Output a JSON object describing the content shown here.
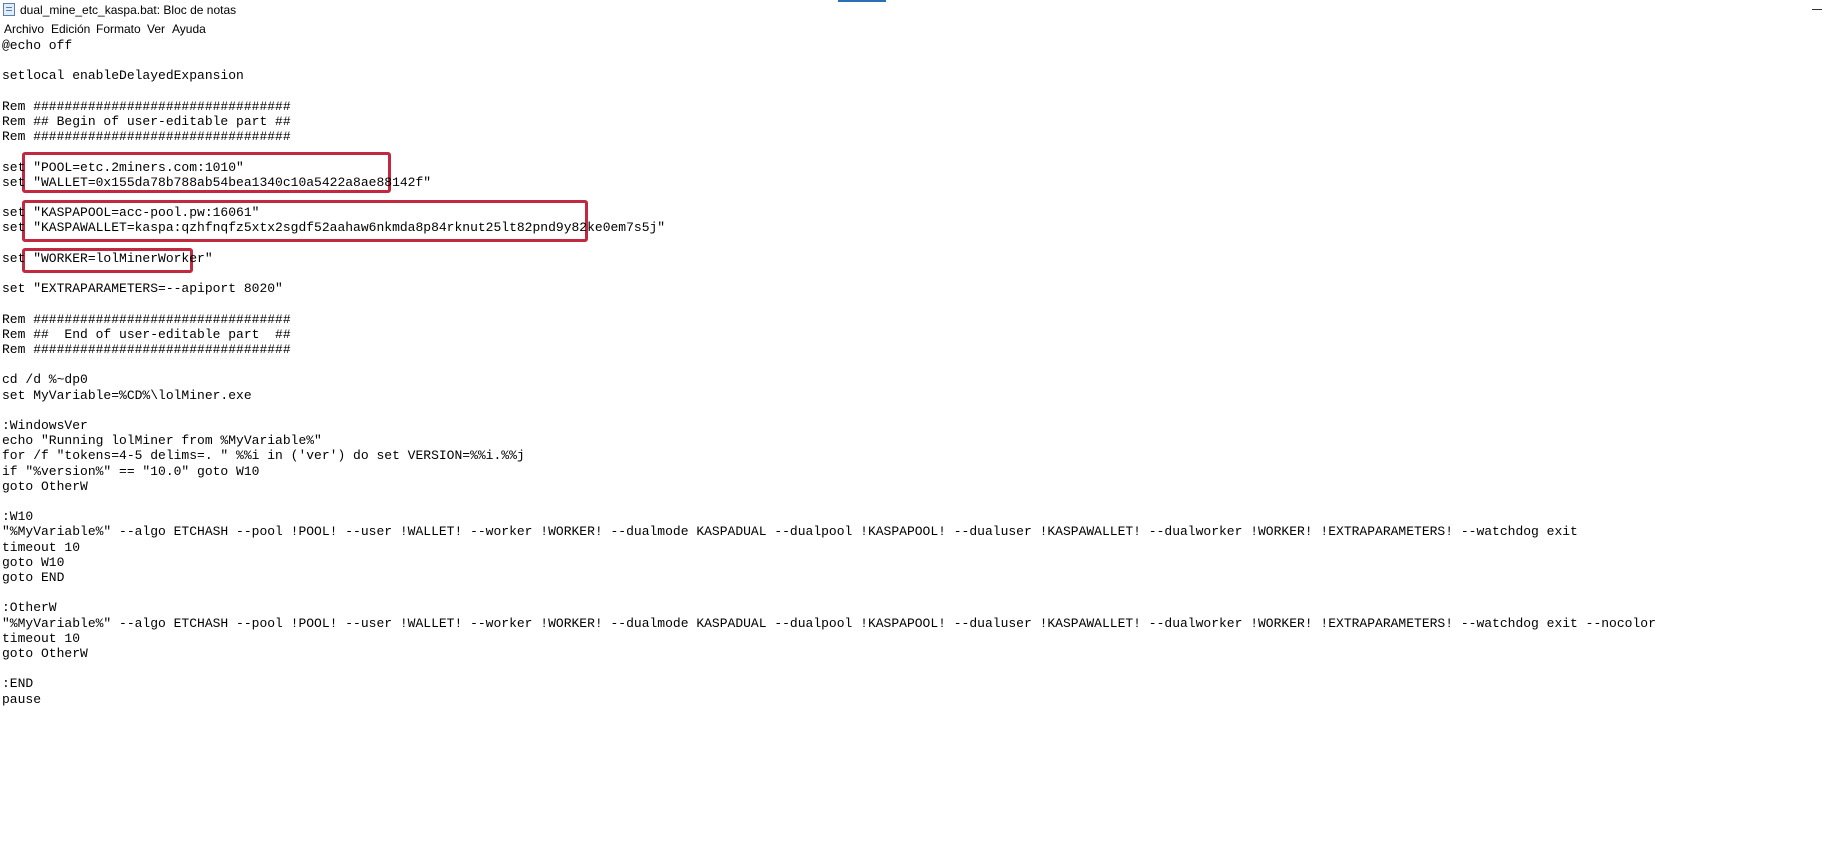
{
  "window": {
    "title": "dual_mine_etc_kaspa.bat: Bloc de notas"
  },
  "menu": [
    {
      "label": "Archivo"
    },
    {
      "label": "Edición"
    },
    {
      "label": "Formato"
    },
    {
      "label": "Ver"
    },
    {
      "label": "Ayuda"
    }
  ],
  "editor": {
    "lines": [
      "@echo off",
      "",
      "setlocal enableDelayedExpansion",
      "",
      "Rem #################################",
      "Rem ## Begin of user-editable part ##",
      "Rem #################################",
      "",
      "set \"POOL=etc.2miners.com:1010\"",
      "set \"WALLET=0x155da78b788ab54bea1340c10a5422a8ae88142f\"",
      "",
      "set \"KASPAPOOL=acc-pool.pw:16061\"",
      "set \"KASPAWALLET=kaspa:qzhfnqfz5xtx2sgdf52aahaw6nkmda8p84rknut25lt82pnd9y82ke0em7s5j\"",
      "",
      "set \"WORKER=lolMinerWorker\"",
      "",
      "set \"EXTRAPARAMETERS=--apiport 8020\"",
      "",
      "Rem #################################",
      "Rem ##  End of user-editable part  ##",
      "Rem #################################",
      "",
      "cd /d %~dp0",
      "set MyVariable=%CD%\\lolMiner.exe",
      "",
      ":WindowsVer",
      "echo \"Running lolMiner from %MyVariable%\"",
      "for /f \"tokens=4-5 delims=. \" %%i in ('ver') do set VERSION=%%i.%%j",
      "if \"%version%\" == \"10.0\" goto W10",
      "goto OtherW",
      "",
      ":W10",
      "\"%MyVariable%\" --algo ETCHASH --pool !POOL! --user !WALLET! --worker !WORKER! --dualmode KASPADUAL --dualpool !KASPAPOOL! --dualuser !KASPAWALLET! --dualworker !WORKER! !EXTRAPARAMETERS! --watchdog exit",
      "timeout 10",
      "goto W10",
      "goto END",
      "",
      ":OtherW",
      "\"%MyVariable%\" --algo ETCHASH --pool !POOL! --user !WALLET! --worker !WORKER! --dualmode KASPADUAL --dualpool !KASPAPOOL! --dualuser !KASPAWALLET! --dualworker !WORKER! !EXTRAPARAMETERS! --watchdog exit --nocolor",
      "timeout 10",
      "goto OtherW",
      "",
      ":END",
      "pause"
    ]
  },
  "colors": {
    "highlight_border": "#c0293f",
    "accent": "#2b6fb6"
  },
  "icons": {
    "app": "notepad-icon",
    "minimize": "minimize-icon"
  }
}
